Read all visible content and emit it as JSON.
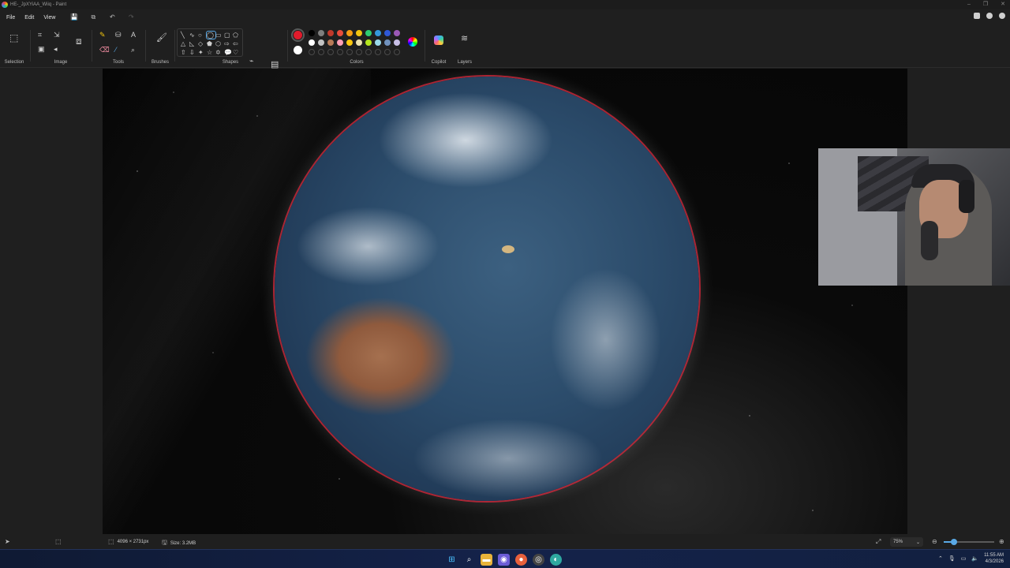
{
  "window": {
    "title": "HE-_JpXYiAA_Wiiq - Paint"
  },
  "menu": {
    "file": "File",
    "edit": "Edit",
    "view": "View"
  },
  "ribbon": {
    "groups": {
      "selection": "Selection",
      "image": "Image",
      "tools": "Tools",
      "brushes": "Brushes",
      "shapes": "Shapes",
      "colors": "Colors",
      "copilot": "Copilot",
      "layers": "Layers"
    },
    "primary_color": "#e01b2c",
    "secondary_color": "#ffffff",
    "swatch_colors": [
      "#000000",
      "#7f7f7f",
      "#c0392b",
      "#e74c3c",
      "#f39c12",
      "#f1c40f",
      "#2ecc71",
      "#3498db",
      "#2f58d6",
      "#9b59b6",
      "#ffffff",
      "#c3c3c3",
      "#b97a57",
      "#ff9fb6",
      "#ffc90e",
      "#efe4b0",
      "#b5e61d",
      "#99d9ea",
      "#7092be",
      "#c8bfe7"
    ]
  },
  "statusbar": {
    "dimensions": "4096 × 2731px",
    "size": "Size: 3.2MB",
    "zoom": "75%",
    "zoom_fraction": 0.2
  },
  "taskbar": {
    "time": "11:55 AM",
    "date": "4/3/2026"
  }
}
